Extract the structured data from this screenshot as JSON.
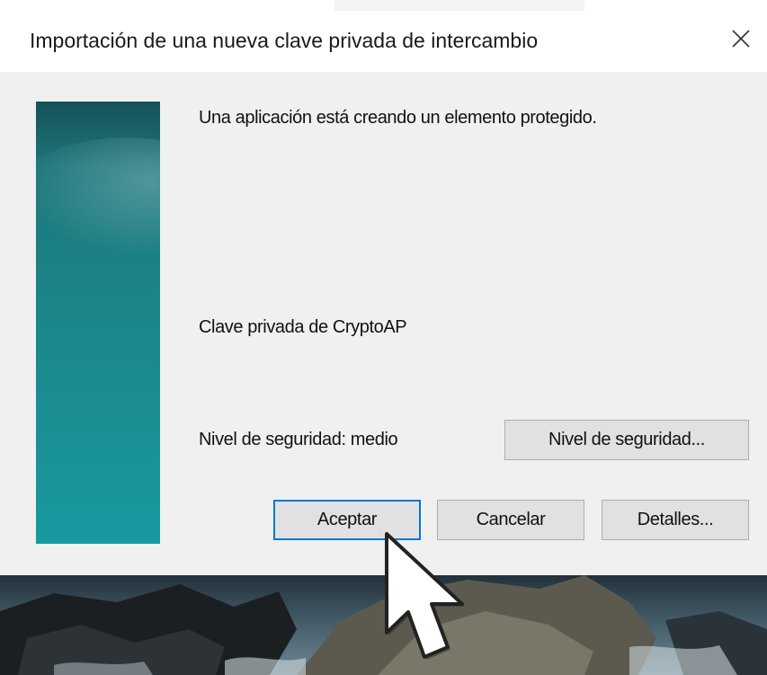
{
  "window": {
    "title": "Importación de una nueva clave privada de intercambio",
    "close_icon": "close-icon"
  },
  "body": {
    "message": "Una aplicación está creando un elemento protegido.",
    "key_name": "Clave privada de CryptoAP",
    "security_level": "Nivel de seguridad: medio"
  },
  "buttons": {
    "security_level": "Nivel de seguridad...",
    "ok": "Aceptar",
    "cancel": "Cancelar",
    "details": "Detalles..."
  },
  "colors": {
    "accent": "#0078d7",
    "side_panel": "#1b8589"
  },
  "icons": {
    "pointer": "mouse-pointer-icon"
  }
}
